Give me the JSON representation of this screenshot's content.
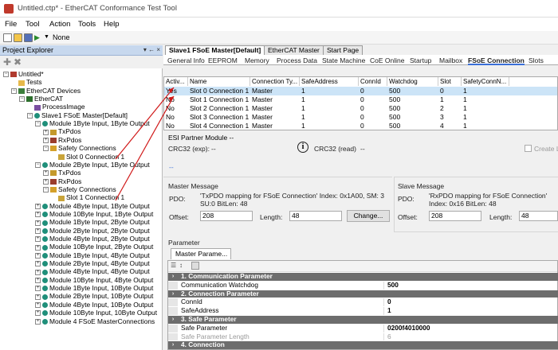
{
  "window": {
    "title": "Untitled.ctp* - EtherCAT Conformance Test Tool"
  },
  "menu": [
    "File",
    "Tool",
    "Action",
    "Tools",
    "Help"
  ],
  "toolbar": {
    "dropdown": "None"
  },
  "explorer": {
    "title": "Project Explorer",
    "buttons": "▾ ← ×",
    "tree": [
      {
        "label": "Untitled*",
        "indent": 0,
        "exp": "-",
        "icon": "project"
      },
      {
        "label": "Tests",
        "indent": 1,
        "exp": "",
        "icon": "folder"
      },
      {
        "label": "EtherCAT Devices",
        "indent": 1,
        "exp": "-",
        "icon": "devices"
      },
      {
        "label": "EtherCAT",
        "indent": 2,
        "exp": "-",
        "icon": "ethercat"
      },
      {
        "label": "ProcessImage",
        "indent": 3,
        "exp": "",
        "icon": "process"
      },
      {
        "label": "Slave1 FSoE Master[Default]",
        "indent": 3,
        "exp": "-",
        "icon": "slave"
      },
      {
        "label": "Module 1Byte Input, 1Byte Output",
        "indent": 4,
        "exp": "-",
        "icon": "module"
      },
      {
        "label": "TxPdos",
        "indent": 5,
        "exp": "+",
        "icon": "txpdo"
      },
      {
        "label": "RxPdos",
        "indent": 5,
        "exp": "+",
        "icon": "rxpdo"
      },
      {
        "label": "Safety Connections",
        "indent": 5,
        "exp": "-",
        "icon": "safety"
      },
      {
        "label": "Slot 0 Connection 1",
        "indent": 6,
        "exp": "",
        "icon": "connection"
      },
      {
        "label": "Module 2Byte Input, 1Byte Output",
        "indent": 4,
        "exp": "-",
        "icon": "module"
      },
      {
        "label": "TxPdos",
        "indent": 5,
        "exp": "+",
        "icon": "txpdo"
      },
      {
        "label": "RxPdos",
        "indent": 5,
        "exp": "+",
        "icon": "rxpdo"
      },
      {
        "label": "Safety Connections",
        "indent": 5,
        "exp": "-",
        "icon": "safety"
      },
      {
        "label": "Slot 1 Connection 1",
        "indent": 6,
        "exp": "",
        "icon": "connection"
      },
      {
        "label": "Module 4Byte Input, 1Byte Output",
        "indent": 4,
        "exp": "+",
        "icon": "module"
      },
      {
        "label": "Module 10Byte Input, 1Byte Output",
        "indent": 4,
        "exp": "+",
        "icon": "module"
      },
      {
        "label": "Module 1Byte Input, 2Byte Output",
        "indent": 4,
        "exp": "+",
        "icon": "module"
      },
      {
        "label": "Module 2Byte Input, 2Byte Output",
        "indent": 4,
        "exp": "+",
        "icon": "module"
      },
      {
        "label": "Module 4Byte Input, 2Byte Output",
        "indent": 4,
        "exp": "+",
        "icon": "module"
      },
      {
        "label": "Module 10Byte Input, 2Byte Output",
        "indent": 4,
        "exp": "+",
        "icon": "module"
      },
      {
        "label": "Module 1Byte Input, 4Byte Output",
        "indent": 4,
        "exp": "+",
        "icon": "module"
      },
      {
        "label": "Module 2Byte Input, 4Byte Output",
        "indent": 4,
        "exp": "+",
        "icon": "module"
      },
      {
        "label": "Module 4Byte Input, 4Byte Output",
        "indent": 4,
        "exp": "+",
        "icon": "module"
      },
      {
        "label": "Module 10Byte Input, 4Byte Output",
        "indent": 4,
        "exp": "+",
        "icon": "module"
      },
      {
        "label": "Module 1Byte Input, 10Byte Output",
        "indent": 4,
        "exp": "+",
        "icon": "module"
      },
      {
        "label": "Module 2Byte Input, 10Byte Output",
        "indent": 4,
        "exp": "+",
        "icon": "module"
      },
      {
        "label": "Module 4Byte Input, 10Byte Output",
        "indent": 4,
        "exp": "+",
        "icon": "module"
      },
      {
        "label": "Module 10Byte Input, 10Byte Output",
        "indent": 4,
        "exp": "+",
        "icon": "module"
      },
      {
        "label": "Module 4 FSoE MasterConnections",
        "indent": 4,
        "exp": "+",
        "icon": "module"
      }
    ]
  },
  "doc_tabs": [
    "Slave1 FSoE Master[Default]",
    "EtherCAT Master",
    "Start Page"
  ],
  "sub_tabs": [
    "General Info",
    "EEPROM",
    "Memory",
    "Process Data",
    "State Machine",
    "CoE Online",
    "Startup",
    "Mailbox",
    "FSoE Connection",
    "Slots"
  ],
  "grid": {
    "headers": [
      "Activ...",
      "Name",
      "Connection Ty...",
      "SafeAddress",
      "ConnId",
      "Watchdog",
      "Slot",
      "SafetyConnN..."
    ],
    "rows": [
      [
        "Yes",
        "Slot 0 Connection 1",
        "Master",
        "1",
        "0",
        "500",
        "0",
        "1"
      ],
      [
        "No",
        "Slot 1 Connection 1",
        "Master",
        "1",
        "0",
        "500",
        "1",
        "1"
      ],
      [
        "No",
        "Slot 2 Connection 1",
        "Master",
        "1",
        "0",
        "500",
        "2",
        "1"
      ],
      [
        "No",
        "Slot 3 Connection 1",
        "Master",
        "1",
        "0",
        "500",
        "3",
        "1"
      ],
      [
        "No",
        "Slot 4 Connection 1",
        "Master",
        "1",
        "0",
        "500",
        "4",
        "1"
      ]
    ]
  },
  "esi": {
    "title": "ESI Partner Module --",
    "crc_exp_label": "CRC32 (exp):",
    "crc_exp_value": "--",
    "crc_read_label": "CRC32 (read)",
    "crc_read_value": "--",
    "create_label": "Create L",
    "link": "--"
  },
  "master_msg": {
    "title": "Master Message",
    "pdo_label": "PDO:",
    "pdo_text": "'TxPDO mapping for FSoE Connection' Index: 0x1A00, SM: 3 SU:0 BitLen: 48",
    "offset_label": "Offset:",
    "offset": "208",
    "length_label": "Length:",
    "length": "48",
    "change": "Change..."
  },
  "slave_msg": {
    "title": "Slave Message",
    "pdo_label": "PDO:",
    "pdo_text": "'RxPDO mapping for FSoE Connection' Index: 0x16 BitLen: 48",
    "offset_label": "Offset:",
    "offset": "208",
    "length_label": "Length:",
    "length": "48"
  },
  "parameter": {
    "title": "Parameter",
    "tab": "Master Parame...",
    "rows": [
      {
        "type": "cat",
        "key": "1. Communication Parameter",
        "value": ""
      },
      {
        "type": "row",
        "key": "Communication Watchdog",
        "value": "500"
      },
      {
        "type": "cat",
        "key": "2. Connection Parameter",
        "value": ""
      },
      {
        "type": "row",
        "key": "ConnId",
        "value": "0"
      },
      {
        "type": "row",
        "key": "SafeAddress",
        "value": "1"
      },
      {
        "type": "cat",
        "key": "3. Safe Parameter",
        "value": ""
      },
      {
        "type": "row",
        "key": "Safe Parameter",
        "value": "0200f4010000"
      },
      {
        "type": "rowgrey",
        "key": "Safe Parameter Length",
        "value": "6"
      },
      {
        "type": "cat",
        "key": "4. Connection",
        "value": ""
      }
    ]
  },
  "colors": {
    "annotation": "#d01818",
    "selection": "#cce4f7",
    "category": "#6d6d6d"
  }
}
